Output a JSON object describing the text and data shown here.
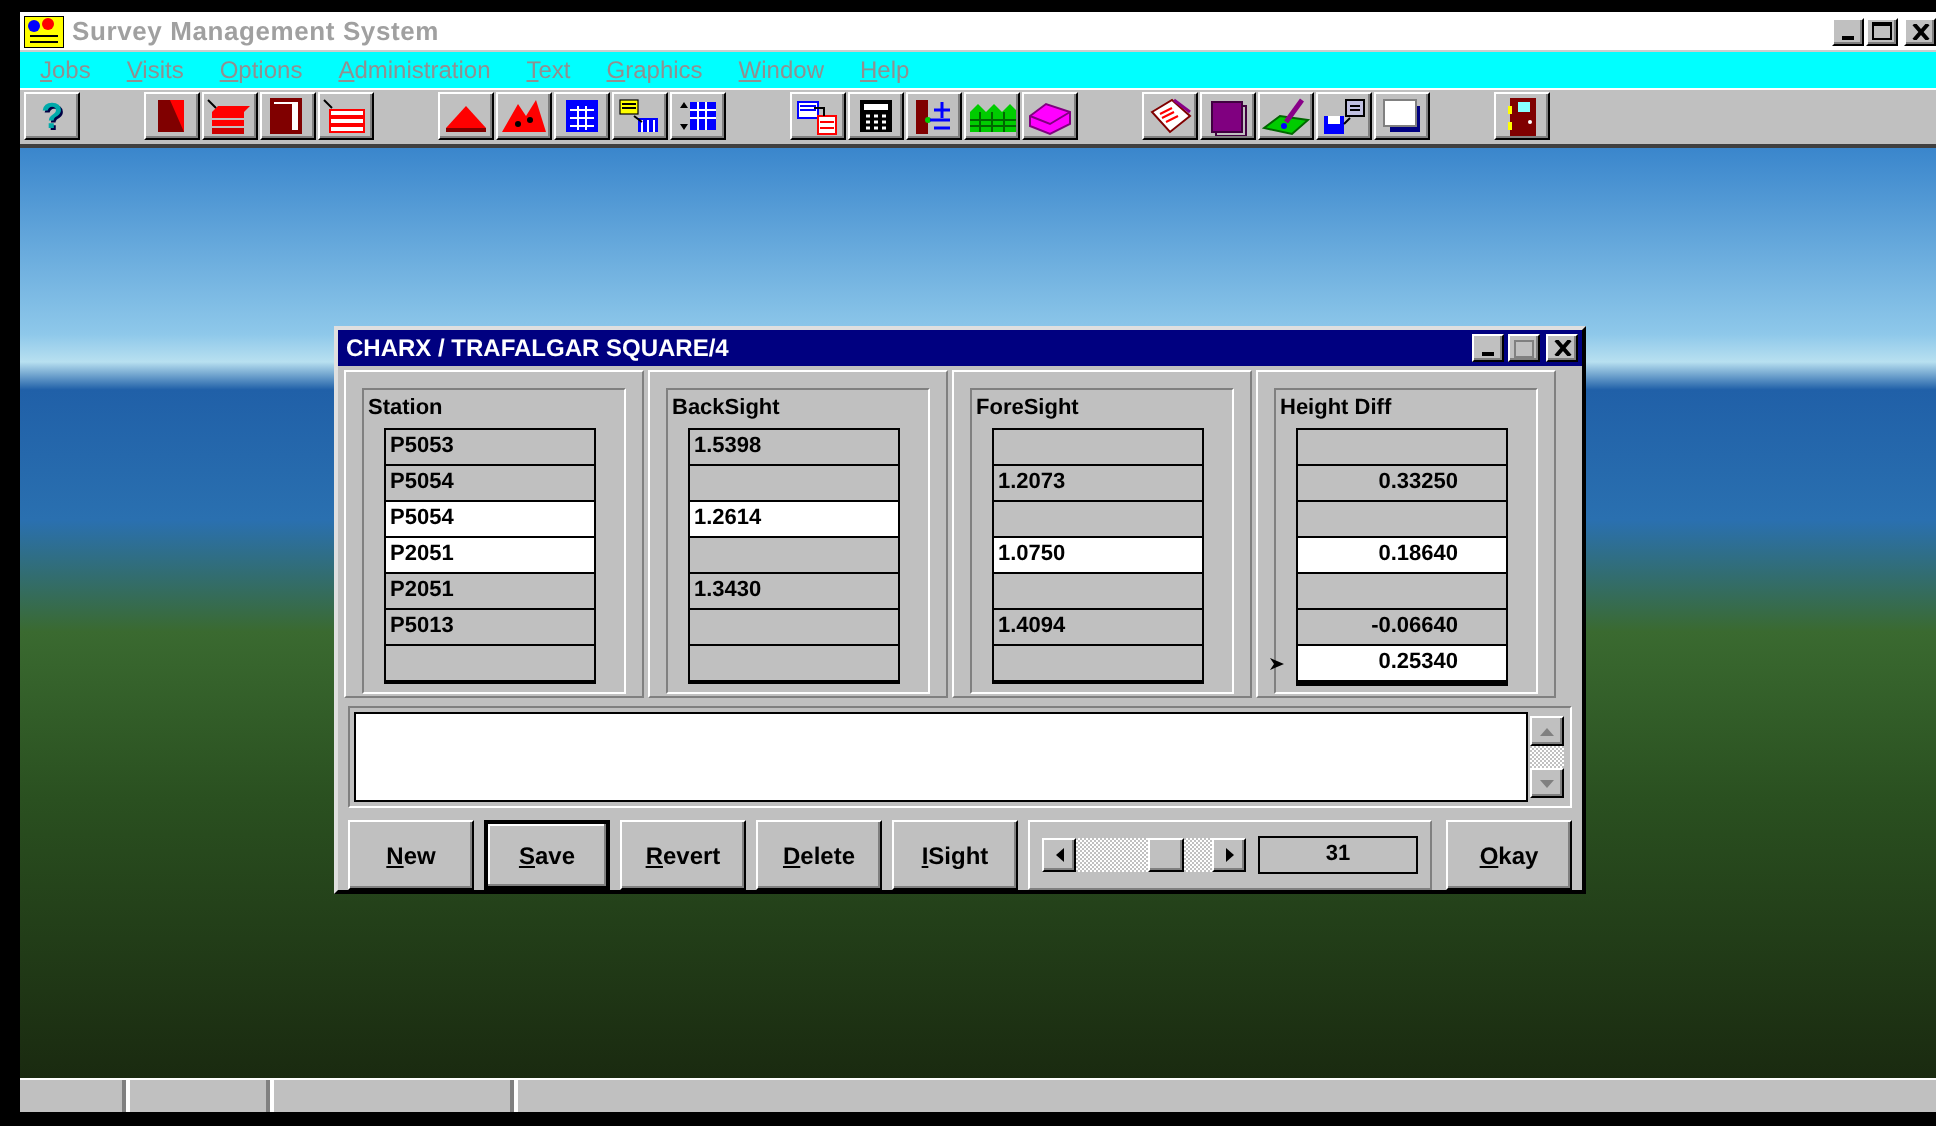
{
  "app": {
    "title": "Survey Management System"
  },
  "menu": [
    {
      "label": "Jobs",
      "disabled": true
    },
    {
      "label": "Visits",
      "disabled": true
    },
    {
      "label": "Options",
      "disabled": true
    },
    {
      "label": "Administration",
      "disabled": true
    },
    {
      "label": "Text",
      "disabled": true
    },
    {
      "label": "Graphics",
      "disabled": true
    },
    {
      "label": "Window",
      "disabled": true
    },
    {
      "label": "Help",
      "disabled": true
    }
  ],
  "toolbar": [
    [
      {
        "kind": "help",
        "label": "?"
      }
    ],
    [
      {
        "kind": "page"
      },
      {
        "kind": "stack"
      },
      {
        "kind": "frame"
      },
      {
        "kind": "stack-outline"
      }
    ],
    [
      {
        "kind": "triangle"
      },
      {
        "kind": "triangles"
      },
      {
        "kind": "table"
      },
      {
        "kind": "list-to-table"
      },
      {
        "kind": "table-arrows"
      }
    ],
    [
      {
        "kind": "doc-transfer"
      },
      {
        "kind": "calculator"
      },
      {
        "kind": "level-staff"
      },
      {
        "kind": "fence"
      },
      {
        "kind": "solid-shape"
      }
    ],
    [
      {
        "kind": "notebook"
      },
      {
        "kind": "book"
      },
      {
        "kind": "pen-pad"
      },
      {
        "kind": "disk-export"
      },
      {
        "kind": "blank-page"
      }
    ],
    [
      {
        "kind": "door"
      }
    ]
  ],
  "dialog": {
    "title": "CHARX / TRAFALGAR SQUARE/4",
    "columns": [
      "Station",
      "BackSight",
      "ForeSight",
      "Height Diff"
    ],
    "rows": [
      {
        "current": false,
        "cells": [
          {
            "text": "P5053",
            "selected": false
          },
          {
            "text": "1.5398",
            "selected": false
          },
          {
            "selected": false
          },
          {
            "selected": false
          }
        ]
      },
      {
        "current": false,
        "cells": [
          {
            "text": "P5054",
            "selected": false
          },
          {
            "selected": false
          },
          {
            "text": "1.2073",
            "selected": false
          },
          {
            "text": "0.33250",
            "selected": false
          }
        ]
      },
      {
        "current": false,
        "cells": [
          {
            "text": "P5054",
            "selected": true
          },
          {
            "text": "1.2614",
            "selected": true
          },
          {
            "selected": false
          },
          {
            "selected": false
          }
        ]
      },
      {
        "current": false,
        "cells": [
          {
            "text": "P2051",
            "selected": true
          },
          {
            "selected": false
          },
          {
            "text": "1.0750",
            "selected": true
          },
          {
            "text": "0.18640",
            "selected": true
          }
        ]
      },
      {
        "current": false,
        "cells": [
          {
            "text": "P2051",
            "selected": false
          },
          {
            "text": "1.3430",
            "selected": false
          },
          {
            "selected": false
          },
          {
            "selected": false
          }
        ]
      },
      {
        "current": false,
        "cells": [
          {
            "text": "P5013",
            "selected": false
          },
          {
            "selected": false
          },
          {
            "text": "1.4094",
            "selected": false
          },
          {
            "text": "-0.06640",
            "selected": false
          }
        ]
      },
      {
        "current": true,
        "cells": [
          {
            "selected": false
          },
          {
            "selected": false
          },
          {
            "selected": false
          },
          {
            "text": "0.25340",
            "selected": true
          }
        ]
      }
    ],
    "buttons": [
      {
        "label": "New",
        "default": false
      },
      {
        "label": "Save",
        "default": true
      },
      {
        "label": "Revert",
        "default": false
      },
      {
        "label": "Delete",
        "default": false
      },
      {
        "label": "ISight",
        "default": false
      }
    ],
    "counter": "31",
    "okay": {
      "label": "Okay",
      "default": false
    }
  }
}
